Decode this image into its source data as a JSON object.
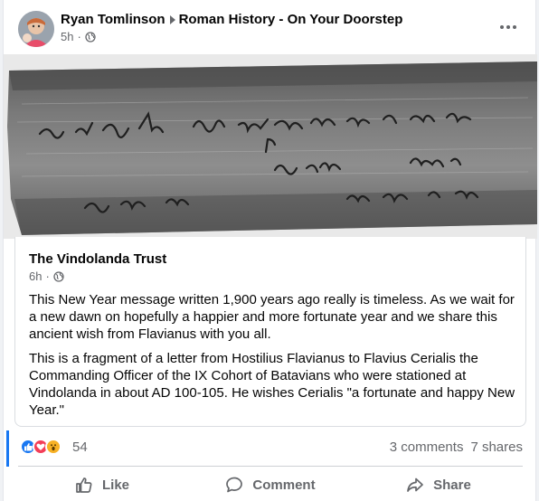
{
  "post": {
    "author": "Ryan Tomlinson",
    "group": "Roman History - On Your Doorstep",
    "time": "5h",
    "dot": "·"
  },
  "shared": {
    "source_name": "The Vindolanda Trust",
    "time": "6h",
    "dot": "·",
    "paragraphs": [
      "This New Year message written 1,900 years ago really is timeless. As we wait for a new dawn on hopefully a happier and more fortunate year and we share this ancient wish from Flavianus with you all.",
      "This is a fragment of a letter from Hostilius Flavianus to Flavius Cerialis the Commanding Officer of the IX Cohort of Batavians who were stationed at Vindolanda in about AD 100-105. He wishes Cerialis \"a fortunate and happy New Year.\""
    ]
  },
  "stats": {
    "reaction_count": "54",
    "comments": "3 comments",
    "shares": "7 shares",
    "reaction_types": [
      "like-icon",
      "love-icon",
      "wow-icon"
    ]
  },
  "actions": {
    "like": "Like",
    "comment": "Comment",
    "share": "Share"
  },
  "colors": {
    "accent": "#1877f2",
    "secondary_text": "#65676b",
    "love": "#f33e58",
    "wow": "#f7b125"
  }
}
